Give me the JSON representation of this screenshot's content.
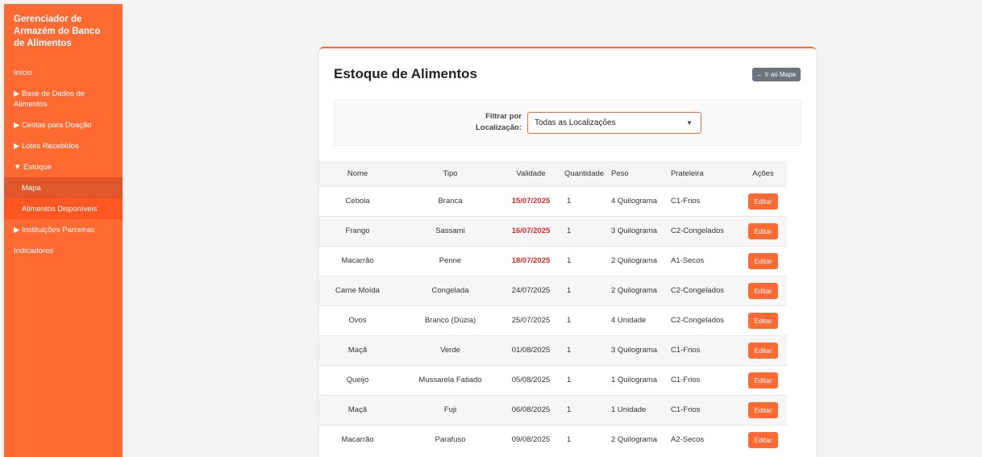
{
  "sidebar": {
    "title": "Gerenciador de Armazém do Banco de Alimentos",
    "items": [
      {
        "label": "Início"
      },
      {
        "label": "▶ Base de Dados de Alimentos"
      },
      {
        "label": "▶ Cestas para Doação"
      },
      {
        "label": "▶ Lotes Recebidos"
      },
      {
        "label": "▼ Estoque"
      },
      {
        "label": "Mapa"
      },
      {
        "label": "Alimentos Disponíveis"
      },
      {
        "label": "▶ Instituições Parceiras"
      },
      {
        "label": "Indicadores"
      }
    ]
  },
  "main": {
    "title": "Estoque de Alimentos",
    "map_button": "← Ir ao Mapa",
    "filter": {
      "label": "Filtrar por Localização:",
      "selected": "Todas as Localizações"
    },
    "table": {
      "headers": [
        "Nome",
        "Tipo",
        "Validade",
        "Quantidade",
        "Peso",
        "Prateleira",
        "Ações"
      ],
      "rows": [
        [
          "Cebola",
          "Branca",
          "15/07/2025",
          "1",
          "4 Quilograma",
          "C1-Frios",
          "Editar"
        ],
        [
          "Frango",
          "Sassami",
          "16/07/2025",
          "1",
          "3 Quilograma",
          "C2-Congelados",
          "Editar"
        ],
        [
          "Macarrão",
          "Penne",
          "18/07/2025",
          "1",
          "2 Quilograma",
          "A1-Secos",
          "Editar"
        ],
        [
          "Carne Moída",
          "Congelada",
          "24/07/2025",
          "1",
          "2 Quilograma",
          "C2-Congelados",
          "Editar"
        ],
        [
          "Ovos",
          "Branco (Dúzia)",
          "25/07/2025",
          "1",
          "4 Unidade",
          "C2-Congelados",
          "Editar"
        ],
        [
          "Maçã",
          "Verde",
          "01/08/2025",
          "1",
          "3 Quilograma",
          "C1-Frios",
          "Editar"
        ],
        [
          "Queijo",
          "Mussarela Fatiado",
          "05/08/2025",
          "1",
          "1 Quilograma",
          "C1-Frios",
          "Editar"
        ],
        [
          "Maçã",
          "Fuji",
          "06/08/2025",
          "1",
          "1 Unidade",
          "C1-Frios",
          "Editar"
        ],
        [
          "Macarrão",
          "Parafuso",
          "09/08/2025",
          "1",
          "2 Quilograma",
          "A2-Secos",
          "Editar"
        ]
      ]
    }
  },
  "colors": {
    "accent": "#ff6a33",
    "expired": "#d62b2b",
    "secondary_button": "#6c757d"
  }
}
